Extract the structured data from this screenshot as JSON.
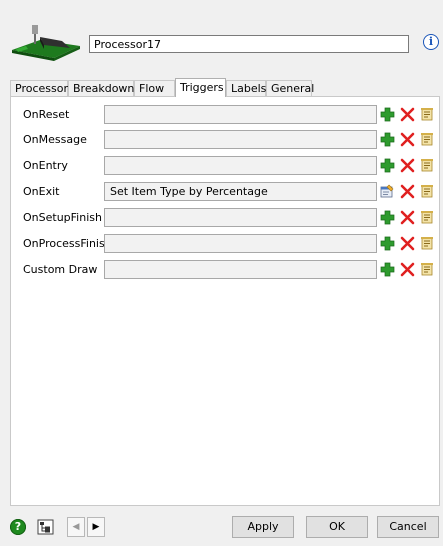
{
  "object": {
    "name": "Processor17"
  },
  "tabs": [
    {
      "label": "Processor",
      "active": false
    },
    {
      "label": "Breakdowns",
      "active": false
    },
    {
      "label": "Flow",
      "active": false
    },
    {
      "label": "Triggers",
      "active": true
    },
    {
      "label": "Labels",
      "active": false
    },
    {
      "label": "General",
      "active": false
    }
  ],
  "triggers": [
    {
      "label": "OnReset",
      "value": ""
    },
    {
      "label": "OnMessage",
      "value": ""
    },
    {
      "label": "OnEntry",
      "value": ""
    },
    {
      "label": "OnExit",
      "value": "Set Item Type by Percentage"
    },
    {
      "label": "OnSetupFinish",
      "value": ""
    },
    {
      "label": "OnProcessFinish",
      "value": ""
    },
    {
      "label": "Custom Draw",
      "value": ""
    }
  ],
  "icons": {
    "info": "info-icon",
    "add": "add-icon",
    "delete": "delete-icon",
    "code": "code-edit-icon",
    "properties": "properties-icon",
    "help": "help-icon",
    "tree": "tree-icon"
  },
  "footer": {
    "help_glyph": "?",
    "prev_glyph": "◀",
    "next_glyph": "▶",
    "apply_label": "Apply",
    "ok_label": "OK",
    "cancel_label": "Cancel"
  },
  "colors": {
    "add_green": "#2e9b2e",
    "delete_red": "#e02020",
    "info_blue": "#1a55b8",
    "help_green": "#1f8a1f"
  }
}
